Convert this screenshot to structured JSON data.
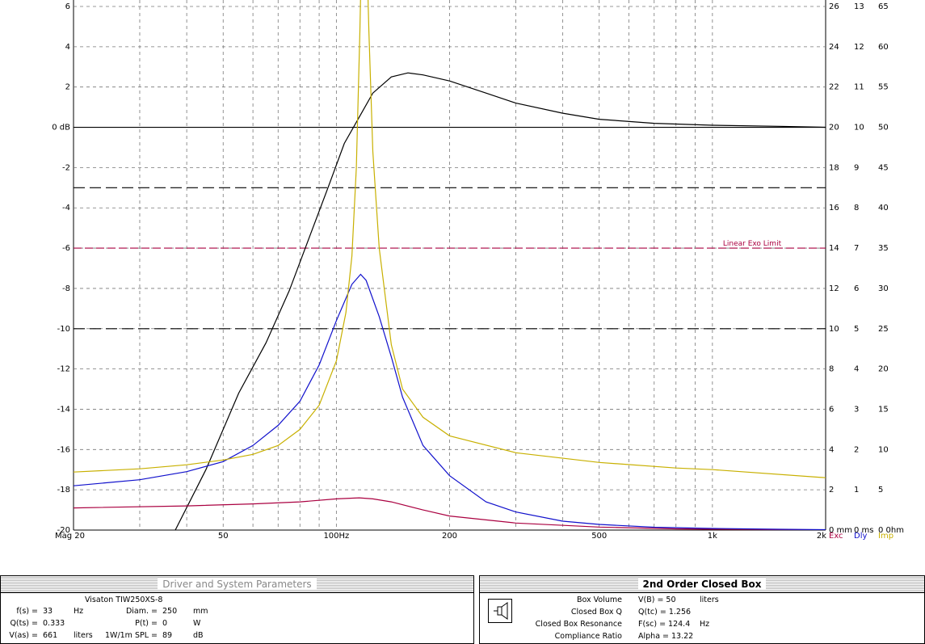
{
  "chart_data": {
    "type": "line",
    "x_scale": "log",
    "x_range_hz": [
      20,
      2000
    ],
    "x_tick_labels": [
      {
        "hz": 20,
        "label": "Mag 20"
      },
      {
        "hz": 50,
        "label": "50"
      },
      {
        "hz": 100,
        "label": "100Hz"
      },
      {
        "hz": 200,
        "label": "200"
      },
      {
        "hz": 500,
        "label": "500"
      },
      {
        "hz": 1000,
        "label": "1k"
      },
      {
        "hz": 2000,
        "label": "2k"
      }
    ],
    "y_range_db": [
      -20,
      6
    ],
    "y_tick_labels": [
      {
        "v": 6,
        "label": "6"
      },
      {
        "v": 4,
        "label": "4"
      },
      {
        "v": 2,
        "label": "2"
      },
      {
        "v": 0,
        "label": "0 dB"
      },
      {
        "v": -2,
        "label": "-2"
      },
      {
        "v": -4,
        "label": "-4"
      },
      {
        "v": -6,
        "label": "-6"
      },
      {
        "v": -8,
        "label": "-8"
      },
      {
        "v": -10,
        "label": "-10"
      },
      {
        "v": -12,
        "label": "-12"
      },
      {
        "v": -14,
        "label": "-14"
      },
      {
        "v": -16,
        "label": "-16"
      },
      {
        "v": -18,
        "label": "-18"
      },
      {
        "v": -20,
        "label": "-20"
      }
    ],
    "right_axes": {
      "exc_mm": [
        "26",
        "24",
        "22",
        "20",
        "18",
        "16",
        "14",
        "12",
        "10",
        "8",
        "6",
        "4",
        "2",
        "0 mm"
      ],
      "dly_ms": [
        "13",
        "12",
        "11",
        "10",
        "9",
        "8",
        "7",
        "6",
        "5",
        "4",
        "3",
        "2",
        "1",
        "0 ms"
      ],
      "imp_ohm": [
        "65",
        "60",
        "55",
        "50",
        "45",
        "40",
        "35",
        "30",
        "25",
        "20",
        "15",
        "10",
        "5",
        "0 0hm"
      ]
    },
    "right_axis_footer": {
      "exc": "Exc",
      "dly": "Dly",
      "imp": "Imp"
    },
    "reference_lines": [
      {
        "y": 0,
        "style": "solid",
        "color": "#000000"
      },
      {
        "y": -3,
        "style": "long-dash",
        "color": "#000000"
      },
      {
        "y": -6,
        "style": "dash",
        "color": "#aa0040",
        "label": "Linear Exo Limit"
      },
      {
        "y": -10,
        "style": "long-dash",
        "color": "#000000"
      }
    ],
    "series": [
      {
        "key": "magnitude",
        "color": "#000000",
        "x": [
          37.3,
          45,
          55,
          65,
          75,
          85,
          95,
          105,
          115,
          125,
          140,
          155,
          170,
          200,
          250,
          300,
          400,
          500,
          700,
          1000,
          1500,
          2000
        ],
        "y": [
          -20,
          -17,
          -13.2,
          -10.7,
          -8.1,
          -5.4,
          -3,
          -0.8,
          0.5,
          1.7,
          2.5,
          2.7,
          2.6,
          2.3,
          1.7,
          1.2,
          0.7,
          0.4,
          0.2,
          0.1,
          0.05,
          0
        ]
      },
      {
        "key": "excursion",
        "color": "#aa0040",
        "axis": "exc",
        "x": [
          20,
          40,
          60,
          80,
          100,
          115,
          125,
          140,
          170,
          200,
          300,
          500,
          800,
          1000,
          2000
        ],
        "y": [
          1.1,
          1.2,
          1.3,
          1.4,
          1.55,
          1.6,
          1.55,
          1.4,
          1.0,
          0.7,
          0.35,
          0.15,
          0.06,
          0.04,
          0.01
        ]
      },
      {
        "key": "delay",
        "color": "#1010cc",
        "axis": "dly",
        "x": [
          20,
          30,
          40,
          50,
          60,
          70,
          80,
          90,
          100,
          110,
          116,
          120,
          130,
          140,
          150,
          170,
          200,
          250,
          300,
          400,
          500,
          700,
          1000,
          1500,
          2000
        ],
        "y": [
          1.1,
          1.25,
          1.45,
          1.7,
          2.1,
          2.6,
          3.2,
          4.1,
          5.2,
          6.1,
          6.35,
          6.2,
          5.3,
          4.3,
          3.3,
          2.1,
          1.35,
          0.7,
          0.45,
          0.22,
          0.14,
          0.07,
          0.04,
          0.02,
          0.01
        ]
      },
      {
        "key": "impedance",
        "color": "#c8b000",
        "axis": "imp",
        "x": [
          20,
          30,
          40,
          50,
          60,
          70,
          80,
          90,
          100,
          106,
          110,
          113,
          115.5,
          117,
          118,
          120,
          122,
          125,
          130,
          140,
          150,
          170,
          200,
          300,
          500,
          800,
          1000,
          2000
        ],
        "y": [
          7.2,
          7.6,
          8.1,
          8.7,
          9.4,
          10.5,
          12.5,
          15.5,
          21,
          27,
          34,
          45,
          62,
          75,
          80,
          75,
          62,
          47,
          35,
          23,
          17.5,
          14,
          11.7,
          9.6,
          8.4,
          7.7,
          7.5,
          6.5
        ]
      }
    ]
  },
  "left_panel": {
    "title": "Driver and System Parameters",
    "driver_name": "Visaton  TIW250XS-8",
    "rows": [
      {
        "label": "f(s) =",
        "value": "33",
        "unit": "Hz",
        "label2": "Diam. =",
        "value2": "250",
        "unit2": "mm"
      },
      {
        "label": "Q(ts) =",
        "value": "0.333",
        "unit": "",
        "label2": "P(t) =",
        "value2": "0",
        "unit2": "W"
      },
      {
        "label": "V(as) =",
        "value": "661",
        "unit": "liters",
        "label2": "1W/1m SPL =",
        "value2": "89",
        "unit2": "dB"
      }
    ]
  },
  "right_panel": {
    "title": "2nd Order Closed Box",
    "icon": "speaker-box-icon",
    "rows": [
      {
        "label": "Box Volume",
        "value": "V(B) = 50",
        "unit": "liters"
      },
      {
        "label": "Closed Box Q",
        "value": "Q(tc) = 1.256",
        "unit": ""
      },
      {
        "label": "Closed Box Resonance",
        "value": "F(sc) = 124.4",
        "unit": "Hz"
      },
      {
        "label": "Compliance Ratio",
        "value": "Alpha = 13.22",
        "unit": ""
      }
    ]
  }
}
